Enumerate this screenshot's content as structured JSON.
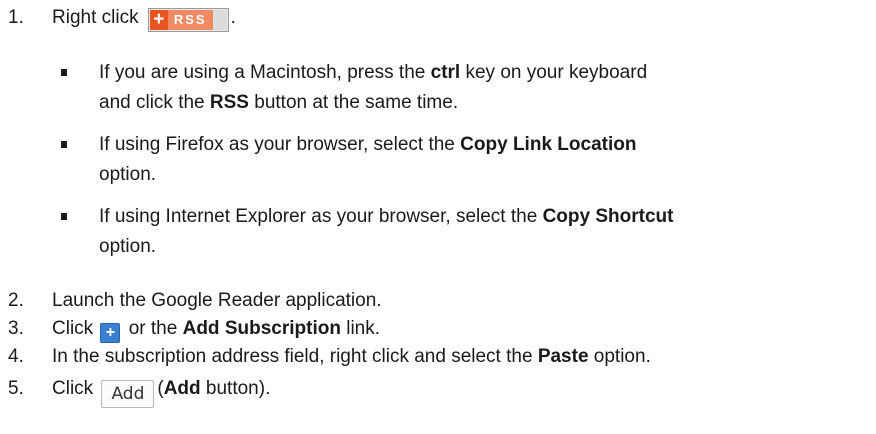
{
  "steps": [
    {
      "number": "1.",
      "text_before": "Right click",
      "text_after": "."
    },
    {
      "number": "2.",
      "text": "Launch the Google Reader application."
    },
    {
      "number": "3.",
      "text_before": "Click",
      "text_mid": "or the",
      "bold": "Add Subscription",
      "text_after": "link."
    },
    {
      "number": "4.",
      "text_before": "In the subscription address field, right click and select the",
      "bold": "Paste",
      "text_after": "option."
    },
    {
      "number": "5.",
      "text_before": "Click",
      "paren_open": "(",
      "bold": "Add",
      "text_after": "button)."
    }
  ],
  "rss_button": {
    "plus": "+",
    "label": "RSS"
  },
  "add_icon": {
    "symbol": "+"
  },
  "add_button": {
    "label": "Add"
  },
  "bullets": [
    {
      "line1_before": "If you are using a Macintosh, press the",
      "line1_bold": "ctrl",
      "line1_after": "key on your keyboard",
      "line2_before": "and click the",
      "line2_bold": "RSS",
      "line2_after": "button at the same time."
    },
    {
      "line1_before": "If using Firefox as your browser, select the",
      "line1_bold": "Copy Link Location",
      "line2": "option."
    },
    {
      "line1_before": "If using Internet Explorer as your browser, select the",
      "line1_bold": "Copy Shortcut",
      "line2": "option."
    }
  ],
  "colors": {
    "rss_plus_bg": "#e8541e",
    "rss_text_bg": "#ef8a65",
    "add_icon_bg": "#3b7fd0"
  }
}
